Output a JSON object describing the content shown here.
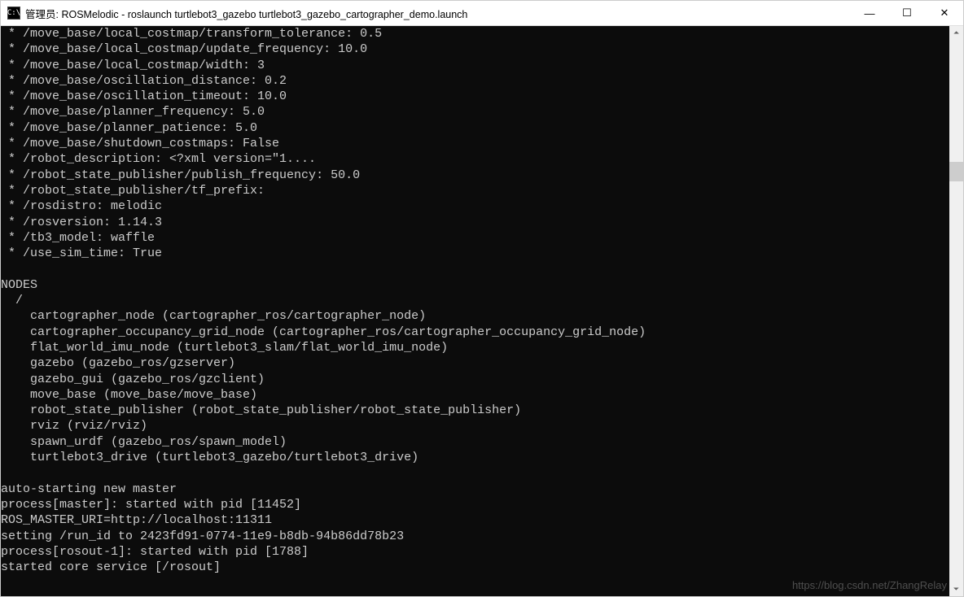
{
  "titlebar": {
    "icon_text": "C:\\",
    "title": "管理员: ROSMelodic - roslaunch  turtlebot3_gazebo turtlebot3_gazebo_cartographer_demo.launch"
  },
  "params": [
    " * /move_base/local_costmap/transform_tolerance: 0.5",
    " * /move_base/local_costmap/update_frequency: 10.0",
    " * /move_base/local_costmap/width: 3",
    " * /move_base/oscillation_distance: 0.2",
    " * /move_base/oscillation_timeout: 10.0",
    " * /move_base/planner_frequency: 5.0",
    " * /move_base/planner_patience: 5.0",
    " * /move_base/shutdown_costmaps: False",
    " * /robot_description: <?xml version=\"1....",
    " * /robot_state_publisher/publish_frequency: 50.0",
    " * /robot_state_publisher/tf_prefix:",
    " * /rosdistro: melodic",
    " * /rosversion: 1.14.3",
    " * /tb3_model: waffle",
    " * /use_sim_time: True"
  ],
  "nodes_header": "NODES",
  "nodes_root": "  /",
  "nodes": [
    "    cartographer_node (cartographer_ros/cartographer_node)",
    "    cartographer_occupancy_grid_node (cartographer_ros/cartographer_occupancy_grid_node)",
    "    flat_world_imu_node (turtlebot3_slam/flat_world_imu_node)",
    "    gazebo (gazebo_ros/gzserver)",
    "    gazebo_gui (gazebo_ros/gzclient)",
    "    move_base (move_base/move_base)",
    "    robot_state_publisher (robot_state_publisher/robot_state_publisher)",
    "    rviz (rviz/rviz)",
    "    spawn_urdf (gazebo_ros/spawn_model)",
    "    turtlebot3_drive (turtlebot3_gazebo/turtlebot3_drive)"
  ],
  "footer": [
    "auto-starting new master",
    "process[master]: started with pid [11452]",
    "ROS_MASTER_URI=http://localhost:11311",
    "setting /run_id to 2423fd91-0774-11e9-b8db-94b86dd78b23",
    "process[rosout-1]: started with pid [1788]",
    "started core service [/rosout]"
  ],
  "watermark": "https://blog.csdn.net/ZhangRelay",
  "winctrl": {
    "min": "—",
    "max": "☐",
    "close": "✕"
  },
  "scroll": {
    "up": "⏶",
    "down": "⏷"
  }
}
